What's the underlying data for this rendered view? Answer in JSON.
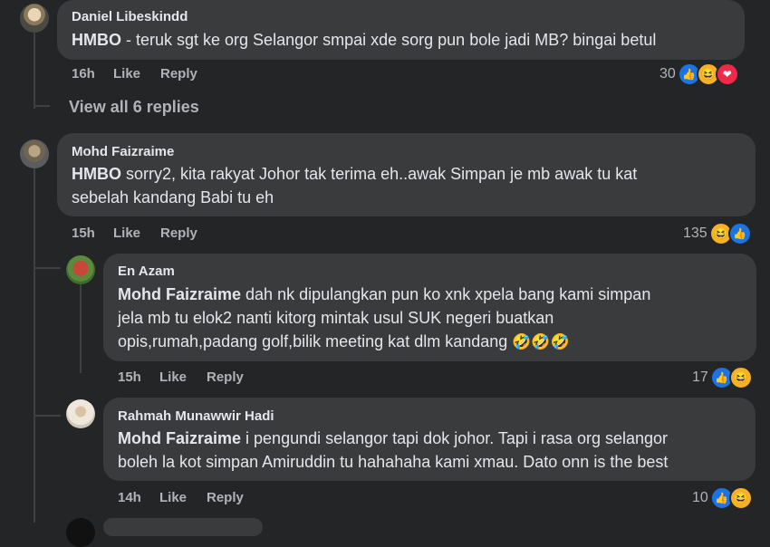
{
  "comments": [
    {
      "author": "Daniel Libeskindd",
      "tag": "HMBO",
      "text": " - teruk sgt ke org Selangor smpai xde sorg pun bole jadi MB? bingai betul",
      "time": "16h",
      "like_label": "Like",
      "reply_label": "Reply",
      "reaction_count": "30",
      "reactions": [
        "like-icon",
        "haha-icon",
        "love-icon"
      ]
    },
    {
      "author": "Mohd Faizraime",
      "tag": "HMBO",
      "text_line1": " sorry2, kita rakyat Johor tak terima eh..awak Simpan je mb awak tu kat",
      "text_line2": "sebelah kandang Babi tu eh",
      "time": "15h",
      "like_label": "Like",
      "reply_label": "Reply",
      "reaction_count": "135",
      "reactions": [
        "haha-icon",
        "like-icon"
      ]
    }
  ],
  "view_replies": "View all 6 replies",
  "replies": [
    {
      "author": "En Azam",
      "tag": "Mohd Faizraime",
      "text_line1": " dah nk dipulangkan pun ko xnk xpela bang kami simpan",
      "text_line2": "jela mb tu elok2 nanti kitorg mintak usul SUK negeri buatkan",
      "text_line3": "opis,rumah,padang golf,bilik meeting kat dlm kandang ",
      "emoji": "🤣🤣🤣",
      "time": "15h",
      "like_label": "Like",
      "reply_label": "Reply",
      "reaction_count": "17",
      "reactions": [
        "like-icon",
        "haha-icon"
      ]
    },
    {
      "author": "Rahmah Munawwir Hadi",
      "tag": "Mohd Faizraime",
      "text_line1": " i pengundi selangor tapi dok johor. Tapi i rasa org selangor",
      "text_line2": "boleh la kot simpan Amiruddin tu hahahaha kami xmau. Dato onn is the best",
      "time": "14h",
      "like_label": "Like",
      "reply_label": "Reply",
      "reaction_count": "10",
      "reactions": [
        "like-icon",
        "haha-icon"
      ]
    }
  ],
  "colors": {
    "background": "#242526",
    "bubble": "#3a3b3c",
    "meta_text": "#b0b3b8",
    "like_blue": "#1b74e4",
    "haha_yellow": "#f7b125",
    "love_red": "#f0284a"
  }
}
